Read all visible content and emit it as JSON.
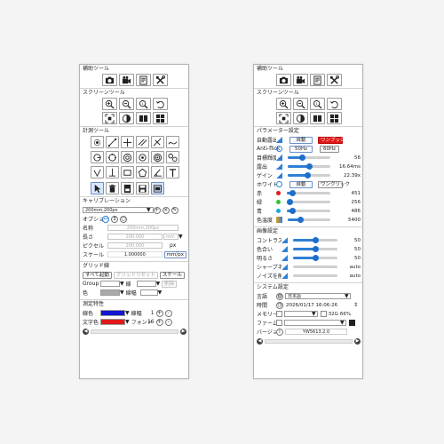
{
  "left": {
    "aux_title": "補助ツール",
    "screen_title": "スクリーンツール",
    "measure_title": "計測ツール",
    "calib": {
      "title": "キャリブレーション",
      "preset": "200mm,200px",
      "option_label": "オプション",
      "name_label": "名称",
      "name_value": "200mm,200px",
      "length_label": "長さ",
      "length_value": "200.000",
      "length_unit": "mm",
      "pixel_label": "ピクセル",
      "pixel_value": "200.000",
      "pixel_unit": "px",
      "scale_label": "スケール",
      "scale_value": "1.000000",
      "scale_unit": "mm/px"
    },
    "grid": {
      "title": "グリッド線",
      "start_label": "すべて起動",
      "reset_label": "グリッドリセット",
      "scale_label": "スケール",
      "group_label": "Group",
      "line_label": "線",
      "delete_label": "削除",
      "color_label": "色",
      "width_label": "線幅"
    },
    "props": {
      "title": "測定特性",
      "line_color_label": "線色",
      "line_color": "#1515d4",
      "line_width_label": "線幅",
      "line_width_value": "1",
      "text_color_label": "文字色",
      "text_color": "#e01818",
      "font_label": "フォント",
      "font_value": "16"
    }
  },
  "right": {
    "aux_title": "補助ツール",
    "screen_title": "スクリーンツール",
    "param": {
      "title": "パラメーター設定",
      "auto_exposure_label": "自動露出",
      "auto_label": "自動",
      "one_push_label": "ワンプッシュ",
      "antiflick_label": "Anti-flick",
      "hz50_label": "50Hz",
      "hz60_label": "60Hz",
      "target_label": "目標輝度",
      "target_value": "56",
      "target_level": 0.34,
      "exposure_label": "露出",
      "exposure_value": "16.64ms",
      "exposure_level": 0.5,
      "gain_label": "ゲイン",
      "gain_value": "22.39x",
      "gain_level": 0.46,
      "wb_label": "ホワイトバラ",
      "wb_auto_label": "自動",
      "wb_oneclick_label": "ワンクリック",
      "red_label": "赤",
      "red_value": "451",
      "red_level": 0.12,
      "green_label": "緑",
      "green_value": "256",
      "green_level": 0.07,
      "blue_label": "青",
      "blue_value": "486",
      "blue_level": 0.13,
      "temp_label": "色温度",
      "temp_value": "5400",
      "temp_level": 0.3
    },
    "image": {
      "title": "画像設定",
      "contrast_label": "コントラス",
      "contrast_value": "50",
      "contrast_level": 0.5,
      "saturation_label": "色合い",
      "saturation_value": "50",
      "saturation_level": 0.5,
      "brightness_label": "明るさ",
      "brightness_value": "50",
      "brightness_level": 0.5,
      "sharpness_label": "シャープネ",
      "sharpness_value": "auto",
      "noise_label": "ノイズを削",
      "noise_value": "auto"
    },
    "system": {
      "title": "システム設定",
      "lang_label": "言語",
      "lang_value": "日本語",
      "time_label": "時間",
      "time_value": "2026/01/17 16:06:26",
      "memory_label": "メモリー",
      "memory_size": "32G",
      "memory_pct": "66%",
      "firmware_label": "ファームウ",
      "version_label": "バージョン",
      "version_value": "YW5613.2.0"
    }
  },
  "icons": {
    "camera": "camera-icon",
    "record": "video-record-icon",
    "report": "report-icon",
    "tools": "tools-icon"
  },
  "colors": {
    "accent": "#2f7fd6",
    "record_red": "#e01818",
    "selected": "#d8e8ff"
  }
}
